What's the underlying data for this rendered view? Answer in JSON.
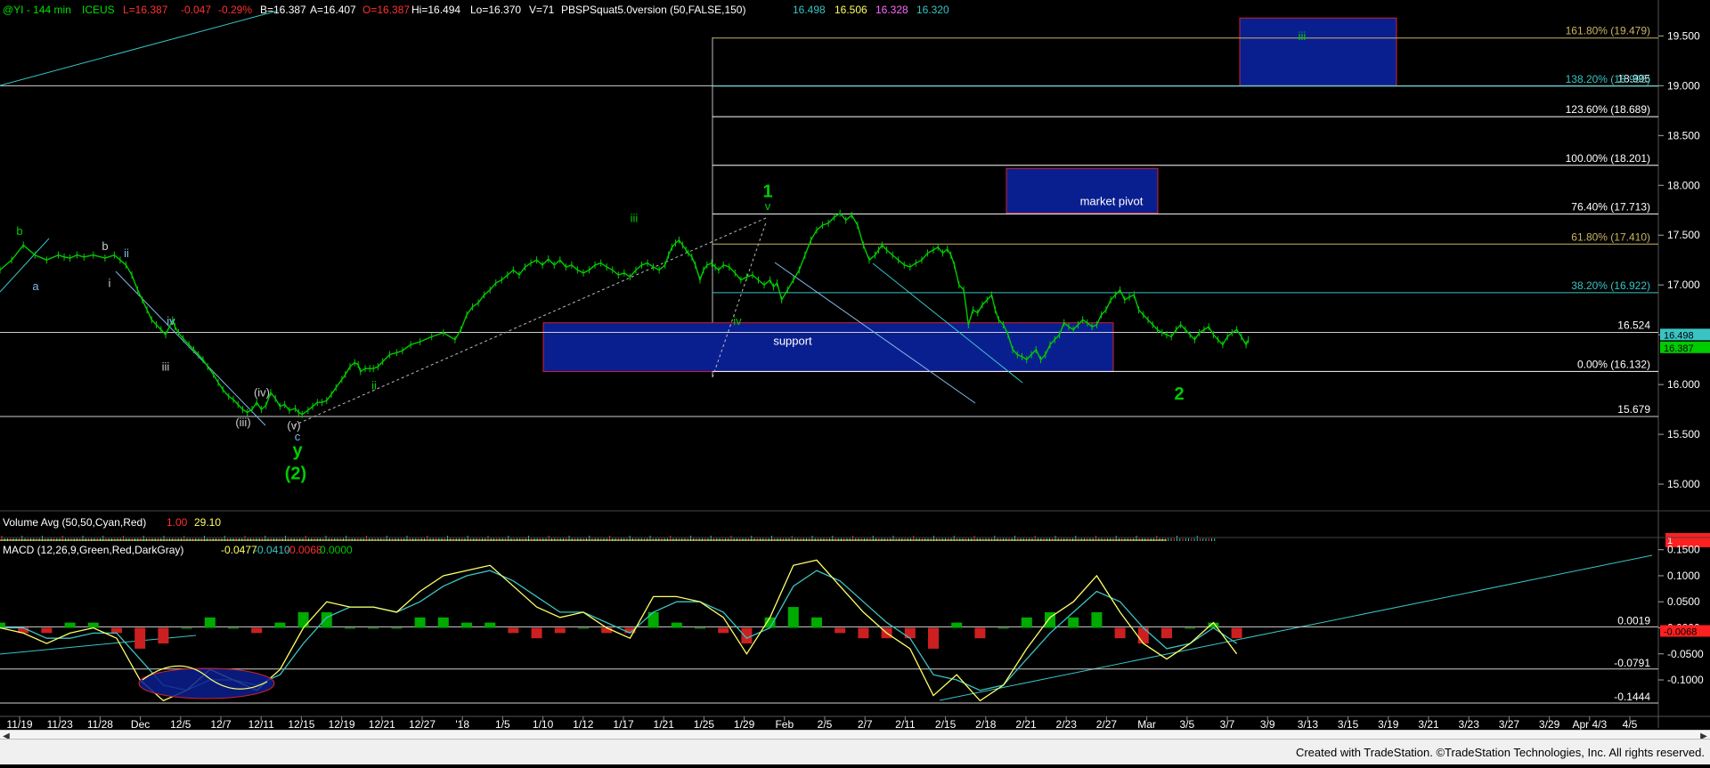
{
  "header": {
    "symbol": "@YI - 144 min",
    "exchange": "ICEUS",
    "last": "L=16.387",
    "change": "-0.047",
    "change_pct": "-0.29%",
    "bid": "B=16.387",
    "ask": "A=16.407",
    "open": "O=16.387",
    "high": "Hi=16.494",
    "low": "Lo=16.370",
    "volume": "V=71",
    "study": "PBSPSquat5.0version (50,FALSE,150)",
    "study_vals": [
      "16.498",
      "16.506",
      "16.328",
      "16.320"
    ]
  },
  "volume_header": {
    "label": "Volume Avg (50,50,Cyan,Red)",
    "v1": "1.00",
    "v2": "29.10",
    "axis_tag": "1"
  },
  "macd_header": {
    "label": "MACD (12,26,9,Green,Red,DarkGray)",
    "v1": "-0.0477",
    "v2": "-0.0410",
    "v3": "-0.0068",
    "v4": "0.0000"
  },
  "colors": {
    "bg": "#000000",
    "price": "#00cc00",
    "cyan": "#3ac3c3",
    "yellow": "#ffff66",
    "box": "#0a1f8f",
    "box_border": "#d4202a",
    "fib_text": "#ffffff",
    "red": "#ff3030"
  },
  "chart_data": [
    {
      "type": "line",
      "name": "price",
      "ylim": [
        14.75,
        19.7
      ],
      "y_ticks": [
        "19.500",
        "19.000",
        "18.500",
        "18.000",
        "17.500",
        "17.000",
        "16.500",
        "16.000",
        "15.500",
        "15.000"
      ],
      "last_tags": [
        "16.498",
        "16.387"
      ],
      "x": [
        0,
        10,
        20,
        30,
        40,
        50,
        55,
        60,
        66,
        72,
        80,
        90,
        98,
        103,
        108,
        113,
        118,
        122,
        126,
        130,
        134,
        138,
        142,
        148,
        150,
        153,
        157,
        162,
        166,
        170,
        174,
        178,
        183,
        187,
        191,
        196,
        200,
        204,
        208,
        212,
        216,
        220,
        224,
        228,
        232,
        236,
        240,
        244,
        248,
        253,
        256,
        259,
        264,
        268,
        272,
        276,
        280,
        284,
        288,
        293,
        296,
        300,
        304,
        307,
        309,
        313,
        317,
        320,
        324,
        328,
        334,
        340,
        345,
        352,
        360,
        370,
        380,
        390,
        395,
        400,
        405,
        410,
        415,
        420,
        425,
        430,
        435,
        440,
        445,
        450,
        455,
        460,
        465,
        470,
        475,
        480,
        485,
        490,
        495,
        500,
        505,
        510,
        515,
        520,
        525,
        530,
        535,
        540,
        545,
        550,
        555,
        560,
        565,
        570,
        573,
        576,
        579,
        582,
        585,
        588,
        590,
        593,
        596,
        600,
        603,
        606,
        610,
        613,
        616,
        620,
        625,
        630,
        635,
        640,
        645,
        650,
        655,
        660,
        663,
        666,
        670,
        675,
        680,
        685,
        690,
        695,
        700,
        705,
        710,
        715,
        720,
        725,
        730,
        735,
        740,
        745,
        750,
        753,
        756,
        760,
        765,
        770,
        775,
        780,
        785,
        790,
        795,
        800,
        804,
        808,
        812,
        815,
        818,
        822,
        826,
        830,
        834,
        838,
        842,
        846,
        850,
        853,
        856,
        860,
        864,
        868,
        872,
        876,
        880,
        884,
        888,
        892,
        896,
        900,
        904,
        908,
        912,
        916,
        920,
        924,
        928,
        932,
        936,
        940,
        944,
        948,
        952,
        956,
        960,
        964,
        968,
        972,
        976,
        980,
        984,
        988,
        992,
        996,
        1000,
        1004,
        1008,
        1012,
        1016,
        1020,
        1024,
        1028,
        1032,
        1036,
        1040,
        1044,
        1048,
        1052,
        1056,
        1060,
        1064,
        1068,
        1070
      ],
      "values": [
        17.15,
        17.25,
        17.4,
        17.3,
        17.25,
        17.3,
        17.28,
        17.27,
        17.3,
        17.28,
        17.3,
        17.27,
        17.3,
        17.25,
        17.2,
        17.1,
        16.95,
        16.85,
        16.75,
        16.65,
        16.6,
        16.55,
        16.5,
        16.65,
        16.58,
        16.52,
        16.46,
        16.4,
        16.35,
        16.3,
        16.25,
        16.18,
        16.1,
        16.02,
        15.95,
        15.88,
        15.85,
        15.8,
        15.75,
        15.72,
        15.75,
        15.82,
        15.75,
        15.79,
        15.92,
        15.86,
        15.78,
        15.8,
        15.74,
        15.76,
        15.72,
        15.7,
        15.74,
        15.78,
        15.82,
        15.82,
        15.84,
        15.9,
        15.97,
        16.05,
        16.1,
        16.18,
        16.22,
        16.2,
        16.13,
        16.16,
        16.16,
        16.16,
        16.18,
        16.23,
        16.3,
        16.32,
        16.34,
        16.4,
        16.43,
        16.48,
        16.52,
        16.45,
        16.55,
        16.7,
        16.78,
        16.82,
        16.9,
        16.95,
        17.02,
        17.05,
        17.1,
        17.15,
        17.1,
        17.18,
        17.22,
        17.25,
        17.2,
        17.26,
        17.2,
        17.25,
        17.18,
        17.2,
        17.15,
        17.12,
        17.15,
        17.2,
        17.22,
        17.18,
        17.15,
        17.1,
        17.12,
        17.08,
        17.15,
        17.2,
        17.22,
        17.18,
        17.15,
        17.2,
        17.3,
        17.38,
        17.42,
        17.45,
        17.4,
        17.35,
        17.32,
        17.28,
        17.2,
        17.05,
        17.15,
        17.2,
        17.22,
        17.18,
        17.15,
        17.2,
        17.18,
        17.12,
        17.05,
        17.08,
        17.1,
        17.05,
        17.0,
        17.05,
        16.98,
        17.02,
        16.85,
        16.95,
        17.05,
        17.15,
        17.3,
        17.45,
        17.55,
        17.6,
        17.62,
        17.68,
        17.72,
        17.65,
        17.7,
        17.6,
        17.4,
        17.25,
        17.3,
        17.35,
        17.4,
        17.35,
        17.3,
        17.25,
        17.2,
        17.18,
        17.22,
        17.25,
        17.32,
        17.35,
        17.38,
        17.32,
        17.36,
        17.3,
        17.2,
        17.0,
        16.95,
        16.6,
        16.75,
        16.72,
        16.8,
        16.85,
        16.9,
        16.75,
        16.65,
        16.6,
        16.5,
        16.35,
        16.3,
        16.28,
        16.25,
        16.3,
        16.35,
        16.25,
        16.3,
        16.4,
        16.45,
        16.5,
        16.62,
        16.58,
        16.55,
        16.6,
        16.65,
        16.62,
        16.58,
        16.6,
        16.7,
        16.75,
        16.85,
        16.9,
        16.95,
        16.85,
        16.88,
        16.9,
        16.75,
        16.7,
        16.65,
        16.6,
        16.55,
        16.52,
        16.5,
        16.48,
        16.55,
        16.6,
        16.55,
        16.5,
        16.45,
        16.52,
        16.55,
        16.58,
        16.5,
        16.45,
        16.4,
        16.48,
        16.52,
        16.55,
        16.48,
        16.4,
        16.45,
        16.5,
        16.52,
        16.4,
        16.35,
        16.38,
        16.42,
        16.39
      ]
    },
    {
      "type": "bar",
      "name": "volume",
      "note": "volume histogram",
      "ylim": [
        0,
        60
      ],
      "values": []
    },
    {
      "type": "line",
      "name": "macd",
      "ylim": [
        -0.17,
        0.17
      ],
      "y_ticks": [
        "0.1500",
        "0.1000",
        "0.0500",
        "0.0000",
        "-0.0500",
        "-0.1000"
      ],
      "ref_lines": [
        {
          "value": 0.0019,
          "label": "0.0019"
        },
        {
          "value": -0.0791,
          "label": "-0.0791"
        },
        {
          "value": -0.1444,
          "label": "-0.1444"
        }
      ],
      "last_tag": "-0.0068",
      "x": [
        0,
        20,
        40,
        60,
        80,
        100,
        120,
        140,
        160,
        180,
        200,
        220,
        240,
        260,
        280,
        300,
        320,
        340,
        360,
        380,
        400,
        420,
        440,
        460,
        480,
        500,
        520,
        540,
        560,
        580,
        600,
        620,
        640,
        660,
        680,
        700,
        720,
        740,
        760,
        780,
        800,
        820,
        840,
        860,
        880,
        900,
        920,
        940,
        960,
        980,
        1000,
        1020,
        1040,
        1060
      ],
      "macd": [
        0.0,
        -0.01,
        -0.03,
        -0.01,
        0.0,
        -0.02,
        -0.1,
        -0.14,
        -0.12,
        -0.08,
        -0.1,
        -0.12,
        -0.08,
        0.0,
        0.05,
        0.04,
        0.04,
        0.03,
        0.07,
        0.1,
        0.11,
        0.12,
        0.08,
        0.04,
        0.02,
        0.03,
        0.0,
        -0.02,
        0.06,
        0.06,
        0.05,
        0.02,
        -0.05,
        0.02,
        0.12,
        0.13,
        0.08,
        0.03,
        -0.01,
        -0.04,
        -0.13,
        -0.09,
        -0.14,
        -0.11,
        -0.04,
        0.02,
        0.05,
        0.1,
        0.03,
        -0.03,
        -0.06,
        -0.03,
        0.01,
        -0.05
      ],
      "signal": [
        0.0,
        0.0,
        -0.02,
        -0.02,
        -0.01,
        -0.01,
        -0.06,
        -0.11,
        -0.12,
        -0.1,
        -0.1,
        -0.11,
        -0.09,
        -0.03,
        0.02,
        0.04,
        0.04,
        0.03,
        0.05,
        0.08,
        0.1,
        0.11,
        0.09,
        0.06,
        0.03,
        0.03,
        0.01,
        -0.01,
        0.03,
        0.05,
        0.05,
        0.03,
        -0.02,
        0.0,
        0.08,
        0.11,
        0.09,
        0.05,
        0.01,
        -0.02,
        -0.09,
        -0.1,
        -0.12,
        -0.11,
        -0.06,
        -0.01,
        0.03,
        0.07,
        0.05,
        0.0,
        -0.04,
        -0.03,
        0.0,
        -0.03
      ],
      "hist": [
        0.01,
        -0.01,
        -0.01,
        0.01,
        0.01,
        -0.01,
        -0.04,
        -0.03,
        0.0,
        0.02,
        0.0,
        -0.01,
        0.01,
        0.03,
        0.03,
        0.0,
        0.0,
        0.0,
        0.02,
        0.02,
        0.01,
        0.01,
        -0.01,
        -0.02,
        -0.01,
        0.0,
        -0.01,
        -0.01,
        0.03,
        0.01,
        0.0,
        -0.01,
        -0.03,
        0.02,
        0.04,
        0.02,
        -0.01,
        -0.02,
        -0.02,
        -0.02,
        -0.04,
        0.01,
        -0.02,
        0.0,
        0.02,
        0.03,
        0.02,
        0.03,
        -0.02,
        -0.03,
        -0.02,
        0.0,
        0.01,
        -0.02
      ]
    }
  ],
  "x_axis_labels": [
    "11/19",
    "11/23",
    "11/28",
    "Dec",
    "12/5",
    "12/7",
    "12/11",
    "12/15",
    "12/19",
    "12/21",
    "12/27",
    "'18",
    "1/5",
    "1/10",
    "1/12",
    "1/17",
    "1/21",
    "1/25",
    "1/29",
    "Feb",
    "2/5",
    "2/7",
    "2/11",
    "2/15",
    "2/18",
    "2/21",
    "2/23",
    "2/27",
    "Mar",
    "3/5",
    "3/7",
    "3/9",
    "3/13",
    "3/15",
    "3/19",
    "3/21",
    "3/23",
    "3/27",
    "3/29",
    "Apr 4/3",
    "4/5"
  ],
  "fib_labels": [
    {
      "text": "161.80% (19.479)",
      "value": 19.479,
      "color": "#c8b464"
    },
    {
      "text": "138.20% (18.995)",
      "value": 18.995,
      "color": "#3ac3c3"
    },
    {
      "text": "123.60% (18.689)",
      "value": 18.689,
      "color": "#ffffff"
    },
    {
      "text": "100.00% (18.201)",
      "value": 18.201,
      "color": "#ffffff"
    },
    {
      "text": "76.40% (17.713)",
      "value": 17.713,
      "color": "#ffffff"
    },
    {
      "text": "61.80% (17.410)",
      "value": 17.41,
      "color": "#c8b464"
    },
    {
      "text": "38.20% (16.922)",
      "value": 16.922,
      "color": "#3ac3c3"
    },
    {
      "text": "0.00% (16.132)",
      "value": 16.132,
      "color": "#ffffff"
    }
  ],
  "hlines": [
    {
      "value": 19.0,
      "label": "18.995"
    },
    {
      "value": 16.524,
      "label": "16.524"
    },
    {
      "value": 15.679,
      "label": "15.679"
    }
  ],
  "boxes": [
    {
      "name": "support",
      "label": "support",
      "x0": 610,
      "x1": 1250,
      "y_top": 16.62,
      "y_bot": 16.13
    },
    {
      "name": "market-pivot",
      "label": "market pivot",
      "x0": 1130,
      "x1": 1300,
      "y_top": 18.17,
      "y_bot": 17.72
    },
    {
      "name": "target-iii",
      "label": "iii",
      "x0": 1392,
      "x1": 1568,
      "y_top": 19.68,
      "y_bot": 19.0
    }
  ],
  "wave_labels": [
    {
      "text": "b",
      "color": "#00cc00",
      "x": 22,
      "y": 17.5
    },
    {
      "text": "a",
      "color": "#7fb8e8",
      "x": 40,
      "y": 16.95
    },
    {
      "text": "b",
      "color": "#cccccc",
      "x": 118,
      "y": 17.35
    },
    {
      "text": "ii",
      "color": "#7fb8e8",
      "x": 142,
      "y": 17.28
    },
    {
      "text": "i",
      "color": "#cccccc",
      "x": 123,
      "y": 16.98
    },
    {
      "text": "iv",
      "color": "#7fb8e8",
      "x": 192,
      "y": 16.6
    },
    {
      "text": "iii",
      "color": "#cccccc",
      "x": 186,
      "y": 16.14
    },
    {
      "text": "(iv)",
      "color": "#cccccc",
      "x": 294,
      "y": 15.88
    },
    {
      "text": "(iii)",
      "color": "#cccccc",
      "x": 273,
      "y": 15.58
    },
    {
      "text": "(v)",
      "color": "#cccccc",
      "x": 330,
      "y": 15.55
    },
    {
      "text": "c",
      "color": "#7fb8e8",
      "x": 334,
      "y": 15.44
    },
    {
      "text": "y",
      "color": "#00cc00",
      "x": 334,
      "y": 15.28
    },
    {
      "text": "(2)",
      "color": "#00cc00",
      "x": 332,
      "y": 15.05
    },
    {
      "text": "ii",
      "color": "#00cc00",
      "x": 420,
      "y": 15.95
    },
    {
      "text": "iii",
      "color": "#00cc00",
      "x": 712,
      "y": 17.63
    },
    {
      "text": "iv",
      "color": "#00cc00",
      "x": 828,
      "y": 16.6
    },
    {
      "text": "v",
      "color": "#00cc00",
      "x": 862,
      "y": 17.75
    },
    {
      "text": "1",
      "color": "#00cc00",
      "x": 862,
      "y": 17.88
    },
    {
      "text": "2",
      "color": "#00cc00",
      "x": 1324,
      "y": 15.85
    },
    {
      "text": "support",
      "color": "#ffffff",
      "x": 890,
      "y": 16.4
    },
    {
      "text": "market pivot",
      "color": "#ffffff",
      "x": 1248,
      "y": 17.8
    },
    {
      "text": "iii",
      "color": "#00cc00",
      "x": 1462,
      "y": 19.46
    }
  ],
  "footer": {
    "credit": "Created with TradeStation. ©TradeStation Technologies, Inc. All rights reserved."
  }
}
